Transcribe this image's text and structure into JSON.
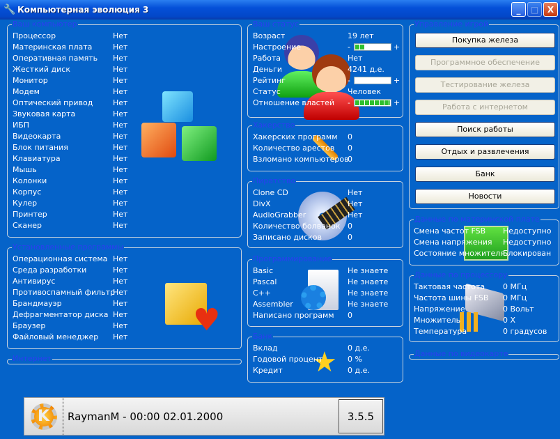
{
  "window": {
    "title": "Компьютерная эволюция 3",
    "icon": "wrench-icon",
    "buttons": [
      "minimize",
      "maximize",
      "close"
    ]
  },
  "computer": {
    "title": "Ваш компьютер",
    "items": [
      {
        "label": "Процессор",
        "value": "Нет"
      },
      {
        "label": "Материнская плата",
        "value": "Нет"
      },
      {
        "label": "Оперативная память",
        "value": "Нет"
      },
      {
        "label": "Жесткий диск",
        "value": "Нет"
      },
      {
        "label": "Монитор",
        "value": "Нет"
      },
      {
        "label": "Модем",
        "value": "Нет"
      },
      {
        "label": "Оптический привод",
        "value": "Нет"
      },
      {
        "label": "Звуковая карта",
        "value": "Нет"
      },
      {
        "label": "ИБП",
        "value": "Нет"
      },
      {
        "label": "Видеокарта",
        "value": "Нет"
      },
      {
        "label": "Блок питания",
        "value": "Нет"
      },
      {
        "label": "Клавиатура",
        "value": "Нет"
      },
      {
        "label": "Мышь",
        "value": "Нет"
      },
      {
        "label": "Колонки",
        "value": "Нет"
      },
      {
        "label": "Корпус",
        "value": "Нет"
      },
      {
        "label": "Кулер",
        "value": "Нет"
      },
      {
        "label": "Принтер",
        "value": "Нет"
      },
      {
        "label": "Сканер",
        "value": "Нет"
      }
    ]
  },
  "programs": {
    "title": "Установленные программы",
    "items": [
      {
        "label": "Операционная система",
        "value": "Нет"
      },
      {
        "label": "Среда разработки",
        "value": "Нет"
      },
      {
        "label": "Антивирус",
        "value": "Нет"
      },
      {
        "label": "Противоспамный фильтр",
        "value": "Нет"
      },
      {
        "label": "Брандмауэр",
        "value": "Нет"
      },
      {
        "label": "Дефрагментатор диска",
        "value": "Нет"
      },
      {
        "label": "Браузер",
        "value": "Нет"
      },
      {
        "label": "Файловый менеджер",
        "value": "Нет"
      }
    ]
  },
  "internet": {
    "title": "Интернет"
  },
  "status": {
    "title": "Ваш статус",
    "age_label": "Возраст",
    "age": "19 лет",
    "mood_label": "Настроение",
    "mood_percent": 25,
    "job_label": "Работа",
    "job": "Нет",
    "money_label": "Деньги",
    "money": "4241 д.е.",
    "rating_label": "Рейтинг",
    "rating_percent": 0,
    "status_label": "Статус",
    "status": "Человек",
    "authority_label": "Отношение властей",
    "authority_percent": 100,
    "minus": "-",
    "plus": "+"
  },
  "hacking": {
    "title": "Хакерство",
    "items": [
      {
        "label": "Хакерских программ",
        "value": "0"
      },
      {
        "label": "Количество арестов",
        "value": "0"
      },
      {
        "label": "Взломано компьютеров",
        "value": "0"
      }
    ]
  },
  "piracy": {
    "title": "Пиратство",
    "items": [
      {
        "label": "Clone CD",
        "value": "Нет"
      },
      {
        "label": "DivX",
        "value": "Нет"
      },
      {
        "label": "AudioGrabber",
        "value": "Нет"
      },
      {
        "label": "Количество болванок",
        "value": "0"
      },
      {
        "label": "Записано дисков",
        "value": "0"
      }
    ]
  },
  "programming": {
    "title": "Программирование",
    "items": [
      {
        "label": "Basic",
        "value": "Не знаете"
      },
      {
        "label": "Pascal",
        "value": "Не знаете"
      },
      {
        "label": "C++",
        "value": "Не знаете"
      },
      {
        "label": "Assembler",
        "value": "Не знаете"
      },
      {
        "label": "Написано программ",
        "value": "0"
      }
    ]
  },
  "bank": {
    "title": "Банк",
    "items": [
      {
        "label": "Вклад",
        "value": "0 д.е."
      },
      {
        "label": "Годовой процент",
        "value": "0 %"
      },
      {
        "label": "Кредит",
        "value": "0 д.е."
      }
    ]
  },
  "control": {
    "title": "Управление игрой",
    "buttons": [
      {
        "label": "Покупка железа",
        "enabled": true
      },
      {
        "label": "Программное обеспечение",
        "enabled": false
      },
      {
        "label": "Тестирование железа",
        "enabled": false
      },
      {
        "label": "Работа с интернетом",
        "enabled": false
      },
      {
        "label": "Поиск работы",
        "enabled": true
      },
      {
        "label": "Отдых и развлечения",
        "enabled": true
      },
      {
        "label": "Банк",
        "enabled": true
      },
      {
        "label": "Новости",
        "enabled": true
      }
    ]
  },
  "motherboard": {
    "title": "Данные по материнской плате",
    "items": [
      {
        "label": "Смена частот FSB",
        "value": "Недоступно"
      },
      {
        "label": "Смена напряжения",
        "value": "Недоступно"
      },
      {
        "label": "Состояние множителя",
        "value": "Блокирован"
      }
    ]
  },
  "cpu": {
    "title": "Данные по процессору",
    "items": [
      {
        "label": "Тактовая частота",
        "value": "0 МГц"
      },
      {
        "label": "Частота шины FSB",
        "value": "0 МГц"
      },
      {
        "label": "Напряжение",
        "value": "0 Вольт"
      },
      {
        "label": "Множитель",
        "value": "0 X"
      },
      {
        "label": "Температура",
        "value": "0 градусов"
      }
    ]
  },
  "video": {
    "title": "Данные по видеокарте"
  },
  "footer": {
    "info": "RaymanM - 00:00 02.01.2000",
    "version": "3.5.5"
  }
}
